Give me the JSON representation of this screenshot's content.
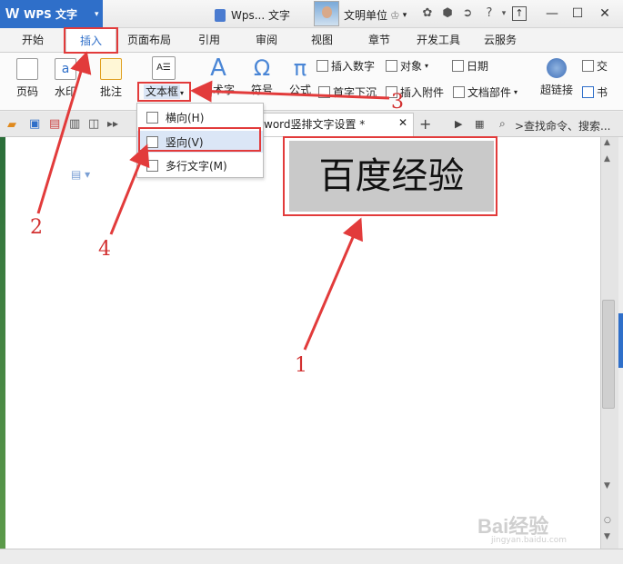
{
  "titlebar": {
    "app_name": "WPS 文字",
    "doc_title": "Wps... 文字",
    "user": "文明单位",
    "help": "?"
  },
  "menu": {
    "tabs": [
      "开始",
      "插入",
      "页面布局",
      "引用",
      "审阅",
      "视图",
      "章节",
      "开发工具",
      "云服务"
    ],
    "active": "插入"
  },
  "ribbon": {
    "page_num": "页码",
    "watermark": "水印",
    "comment": "批注",
    "textbox": "文本框",
    "art": "艺术字",
    "symbol": "符号",
    "formula": "公式",
    "insert_number": "插入数字",
    "object": "对象",
    "date": "日期",
    "drop_cap": "首字下沉",
    "attachment": "插入附件",
    "doc_parts": "文档部件",
    "hyperlink": "超链接",
    "cross": "交",
    "bookmark": "书"
  },
  "tabbar": {
    "doc_tab": "word竖排文字设置 *",
    "search_placeholder": ">查找命令、搜索..."
  },
  "dropdown": {
    "items": [
      "横向(H)",
      "竖向(V)",
      "多行文字(M)"
    ]
  },
  "document": {
    "text": "百度经验"
  },
  "annotations": {
    "n1": "1",
    "n2": "2",
    "n3": "3",
    "n4": "4"
  },
  "watermark": {
    "brand": "Bai经验",
    "url": "jingyan.baidu.com"
  },
  "colors": {
    "accent": "#2f6fc9",
    "highlight": "#e23b3b"
  }
}
